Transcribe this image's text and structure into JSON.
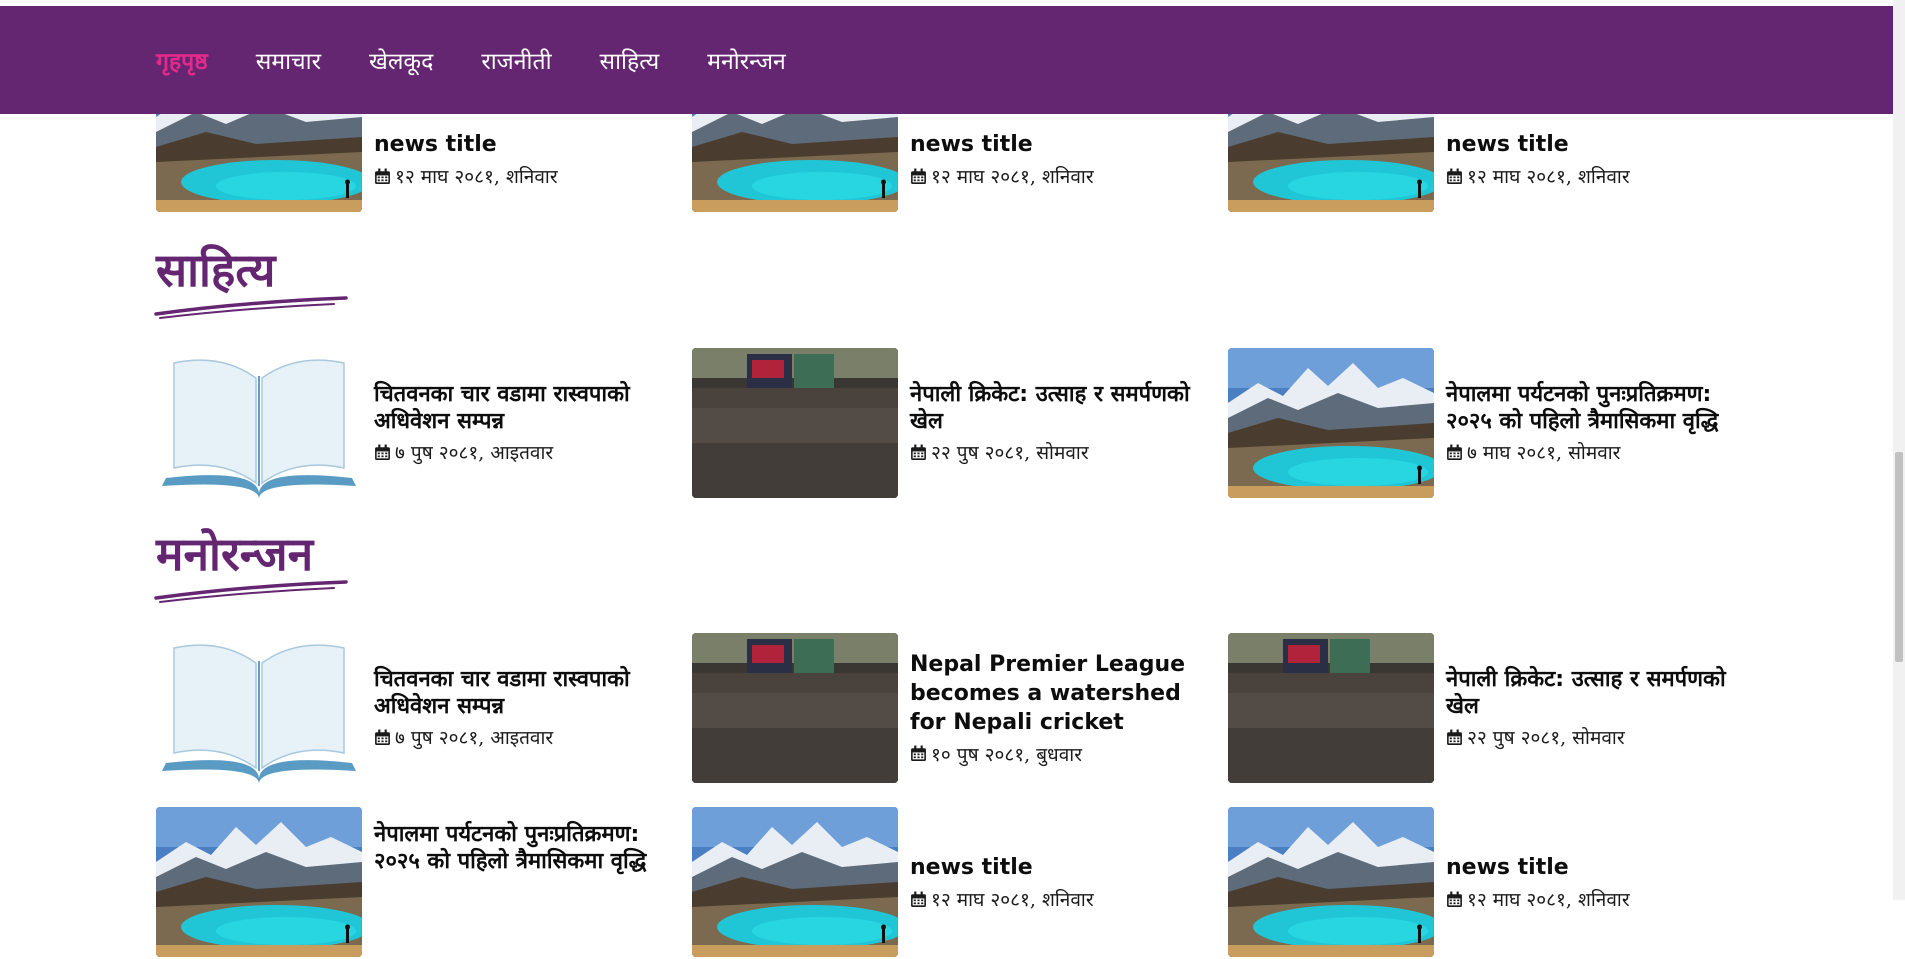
{
  "nav": {
    "items": [
      {
        "label": "गृहपृष्ठ",
        "active": true
      },
      {
        "label": "समाचार",
        "active": false
      },
      {
        "label": "खेलकूद",
        "active": false
      },
      {
        "label": "राजनीती",
        "active": false
      },
      {
        "label": "साहित्य",
        "active": false
      },
      {
        "label": "मनोरन्जन",
        "active": false
      }
    ]
  },
  "top_row": [
    {
      "title": "news title",
      "date": "१२ माघ २०८१, शनिवार",
      "image": "lake-mountain"
    },
    {
      "title": "news title",
      "date": "१२ माघ २०८१, शनिवार",
      "image": "lake-mountain"
    },
    {
      "title": "news title",
      "date": "१२ माघ २०८१, शनिवार",
      "image": "lake-mountain"
    }
  ],
  "sections": [
    {
      "title": "साहित्य",
      "rows": [
        [
          {
            "title": "चितवनका चार वडामा रास्वपाको अधिवेशन सम्पन्न",
            "date": "७ पुष २०८१, आइतवार",
            "image": "open-book"
          },
          {
            "title": "नेपाली क्रिकेट: उत्साह र समर्पणको खेल",
            "date": "२२ पुष २०८१, सोमवार",
            "image": "stadium-crowd"
          },
          {
            "title": "नेपालमा पर्यटनको पुनःप्रतिक्रमण: २०२५ को पहिलो त्रैमासिकमा वृद्धि",
            "date": "७ माघ २०८१, सोमवार",
            "image": "lake-mountain"
          }
        ]
      ]
    },
    {
      "title": "मनोरन्जन",
      "rows": [
        [
          {
            "title": "चितवनका चार वडामा रास्वपाको अधिवेशन सम्पन्न",
            "date": "७ पुष २०८१, आइतवार",
            "image": "open-book"
          },
          {
            "title": "Nepal Premier League becomes a watershed for Nepali cricket",
            "date": "१० पुष २०८१, बुधवार",
            "image": "stadium-crowd"
          },
          {
            "title": "नेपाली क्रिकेट: उत्साह र समर्पणको खेल",
            "date": "२२ पुष २०८१, सोमवार",
            "image": "stadium-crowd"
          }
        ],
        [
          {
            "title": "नेपालमा पर्यटनको पुनःप्रतिक्रमण: २०२५ को पहिलो त्रैमासिकमा वृद्धि",
            "date": "",
            "image": "lake-mountain"
          },
          {
            "title": "news title",
            "date": "१२ माघ २०८१, शनिवार",
            "image": "lake-mountain"
          },
          {
            "title": "news title",
            "date": "१२ माघ २०८१, शनिवार",
            "image": "lake-mountain"
          }
        ]
      ]
    }
  ],
  "colors": {
    "navbar": "#652671",
    "nav_active": "#e3298a",
    "section_title": "#652671"
  },
  "icons": {
    "date": "calendar-icon"
  }
}
